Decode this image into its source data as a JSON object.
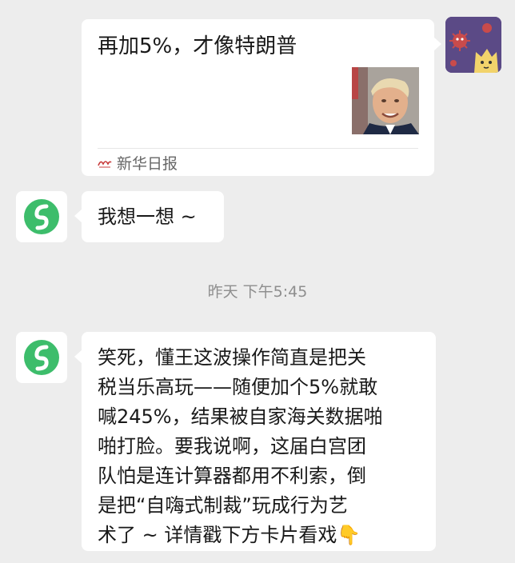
{
  "conversation": {
    "card": {
      "title": "再加5%，才像特朗普",
      "source": "新华日报",
      "source_logo_text": "新华日报"
    },
    "message_short": "我想一想 ~",
    "timestamp": "昨天 下午5:45",
    "message_long_lines": [
      "笑死，懂王这波操作简直是把关",
      "税当乐高玩——随便加个5%就敢",
      "喊245%，结果被自家海关数据啪",
      "啪打脸。要我说啊，这届白宫团",
      "队怕是连计算器都用不利索，倒",
      "是把“自嗨式制裁”玩成行为艺",
      "术了 ~ 详情戳下方卡片看戏👇"
    ]
  },
  "colors": {
    "background": "#ededed",
    "bubble": "#ffffff",
    "bot_logo_green": "#3dbd6b",
    "user_avatar_purple": "#5b4a86"
  },
  "icons": {
    "bot_avatar": "green-s-logo-icon",
    "user_avatar": "cartoon-cat-virus-icon",
    "pointing_down": "pointing-down-emoji"
  }
}
